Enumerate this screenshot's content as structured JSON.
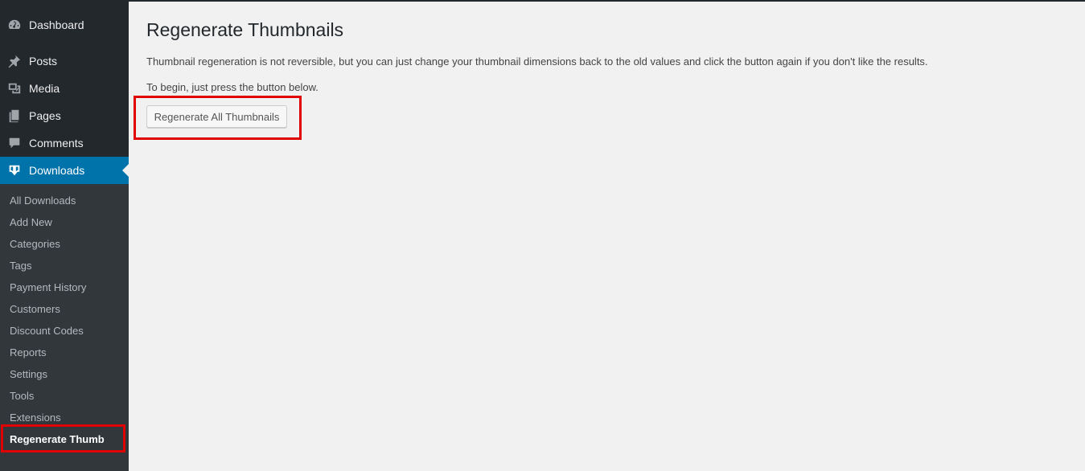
{
  "sidebar": {
    "menu": [
      {
        "label": "Dashboard",
        "icon": "dashboard-icon"
      },
      {
        "label": "Posts",
        "icon": "pin-icon"
      },
      {
        "label": "Media",
        "icon": "media-icon"
      },
      {
        "label": "Pages",
        "icon": "pages-icon"
      },
      {
        "label": "Comments",
        "icon": "comment-icon"
      },
      {
        "label": "Downloads",
        "icon": "download-icon",
        "active": true
      }
    ],
    "submenu": [
      {
        "label": "All Downloads"
      },
      {
        "label": "Add New"
      },
      {
        "label": "Categories"
      },
      {
        "label": "Tags"
      },
      {
        "label": "Payment History"
      },
      {
        "label": "Customers"
      },
      {
        "label": "Discount Codes"
      },
      {
        "label": "Reports"
      },
      {
        "label": "Settings"
      },
      {
        "label": "Tools"
      },
      {
        "label": "Extensions"
      },
      {
        "label": "Regenerate Thumb",
        "current": true
      }
    ]
  },
  "main": {
    "title": "Regenerate Thumbnails",
    "description": "Thumbnail regeneration is not reversible, but you can just change your thumbnail dimensions back to the old values and click the button again if you don't like the results.",
    "instruction": "To begin, just press the button below.",
    "button_label": "Regenerate All Thumbnails"
  },
  "colors": {
    "sidebar_bg": "#23282d",
    "submenu_bg": "#32373c",
    "active_bg": "#0073aa",
    "highlight": "#e00000",
    "page_bg": "#f1f1f1"
  }
}
